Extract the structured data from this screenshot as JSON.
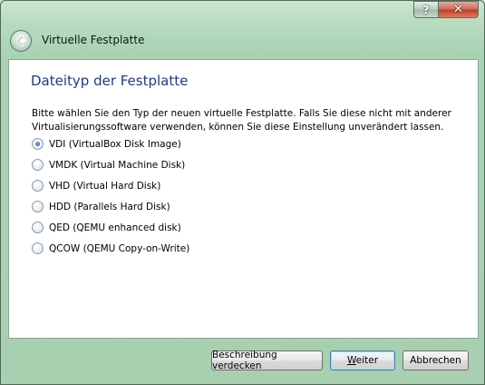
{
  "window": {
    "title": "Virtuelle Festplatte",
    "help_label": "?",
    "close_label": "✕"
  },
  "page": {
    "heading": "Dateityp der Festplatte",
    "description": "Bitte wählen Sie den Typ der neuen virtuelle Festplatte. Falls Sie diese nicht mit anderer Virtualisierungssoftware verwenden, können Sie diese Einstellung unverändert lassen."
  },
  "options": [
    {
      "label": "VDI (VirtualBox Disk Image)",
      "checked": true
    },
    {
      "label": "VMDK (Virtual Machine Disk)",
      "checked": false
    },
    {
      "label": "VHD (Virtual Hard Disk)",
      "checked": false
    },
    {
      "label": "HDD (Parallels Hard Disk)",
      "checked": false
    },
    {
      "label": "QED (QEMU enhanced disk)",
      "checked": false
    },
    {
      "label": "QCOW (QEMU Copy-on-Write)",
      "checked": false
    }
  ],
  "buttons": {
    "hide_description": "Beschreibung verdecken",
    "next_first": "W",
    "next_rest": "eiter",
    "cancel": "Abbrechen"
  },
  "colors": {
    "heading": "#1e3a8a",
    "frame": "#a9d2b2",
    "close": "#c03a22"
  },
  "icons": {
    "back": "back-arrow-icon",
    "help": "help-icon",
    "close": "close-icon"
  }
}
